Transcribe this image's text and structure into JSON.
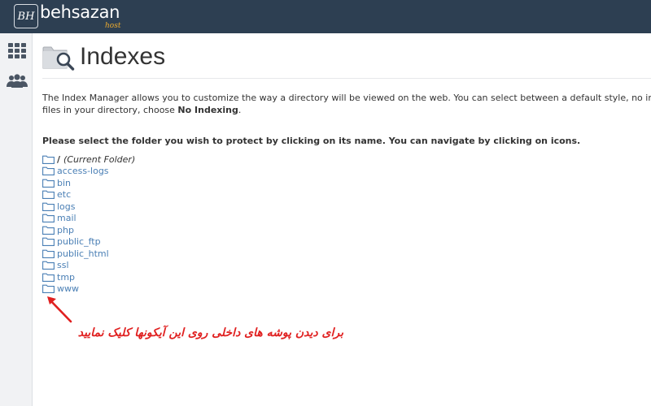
{
  "brand": {
    "mark": "BH",
    "name": "behsazan",
    "sub": "host",
    "accent": "#f0ad2e",
    "topbar_color": "#2d3f52"
  },
  "sidebar": {
    "items": [
      {
        "icon": "grid-icon"
      },
      {
        "icon": "users-icon"
      }
    ]
  },
  "page": {
    "icon": "folder-search-icon",
    "title": "Indexes",
    "description_line1": "The Index Manager allows you to customize the way a directory will be viewed on the web. You can select between a default style, no indexes, or",
    "description_line2_prefix": "files in your directory, choose ",
    "description_line2_bold": "No Indexing",
    "description_line2_suffix": ".",
    "instruction": "Please select the folder you wish to protect by clicking on its name. You can navigate by clicking on icons."
  },
  "folders": {
    "root": {
      "slash": "/",
      "label": "(Current Folder)"
    },
    "items": [
      "access-logs",
      "bin",
      "etc",
      "logs",
      "mail",
      "php",
      "public_ftp",
      "public_html",
      "ssl",
      "tmp",
      "www"
    ],
    "link_color": "#4a7fb5"
  },
  "annotation": {
    "text": "برای دیدن پوشه های داخلی روی این آیکونها کلیک نمایید",
    "color": "#e02020"
  }
}
